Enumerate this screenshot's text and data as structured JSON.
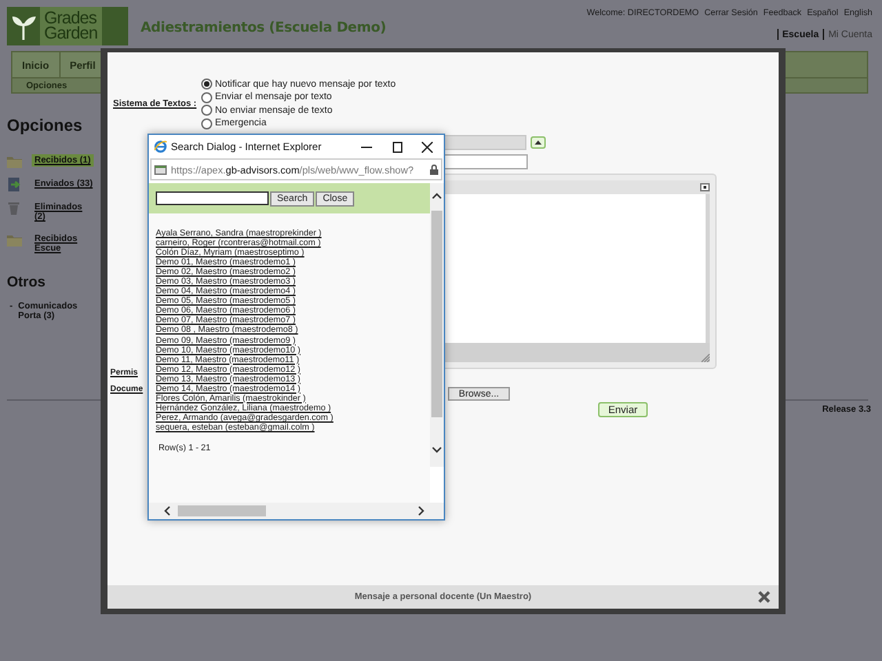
{
  "header": {
    "logo_words": [
      "Grades",
      "Garden"
    ],
    "title": "Adiestramientos (Escuela Demo)",
    "top_links": [
      "Welcome: DIRECTORDEMO",
      "Cerrar Sesión",
      "Feedback",
      "Español",
      "English"
    ],
    "account_links": [
      {
        "label": "Escuela",
        "selected": true
      },
      {
        "label": "Mi Cuenta",
        "selected": false
      }
    ]
  },
  "nav": {
    "tabs": [
      "Inicio",
      "Perfil"
    ],
    "subnav": [
      "Opciones"
    ]
  },
  "sidebar": {
    "heading": "Opciones",
    "items": [
      {
        "label": "Recibidos (1)",
        "kind": "folder",
        "selected": true
      },
      {
        "label": "Enviados (33)",
        "kind": "sent",
        "selected": false
      },
      {
        "label": "Eliminados (2)",
        "kind": "trash",
        "selected": false
      },
      {
        "label": "Recibidos Escue",
        "kind": "folder",
        "selected": false
      }
    ],
    "others_heading": "Otros",
    "others": [
      {
        "marker": "-",
        "label": "Comunicados Porta (3)"
      }
    ]
  },
  "release": "Release 3.3",
  "modal": {
    "sms_label": "Sistema de Textos :",
    "sms_options": [
      {
        "label": "Notificar que hay nuevo mensaje por texto",
        "selected": true
      },
      {
        "label": "Enviar el mensaje por texto",
        "selected": false
      },
      {
        "label": "No enviar mensaje de texto",
        "selected": false
      },
      {
        "label": "Emergencia",
        "selected": false
      }
    ],
    "permissions_label": "Permis",
    "document_label": "Docume",
    "browse_button": "Browse...",
    "send_button": "Enviar",
    "footer_title": "Mensaje a personal docente (Un Maestro)"
  },
  "popup": {
    "title": "Search Dialog - Internet Explorer",
    "url": [
      "https://apex.",
      "gb-advisors.com",
      "/pls/web/wwv_flow.show?"
    ],
    "search_button": "Search",
    "close_button": "Close",
    "results": [
      "Ayala Serrano, Sandra (maestroprekinder )",
      "carneiro, Roger (rcontreras@hotmail.com )",
      "Colón Díaz, Myriam (maestroseptimo )",
      "Demo 01, Maestro (maestrodemo1 )",
      "Demo 02, Maestro (maestrodemo2 )",
      "Demo 03, Maestro (maestrodemo3 )",
      "Demo 04, Maestro (maestrodemo4 )",
      "Demo 05, Maestro (maestrodemo5 )",
      "Demo 06, Maestro (maestrodemo6 )",
      "Demo 07, Maestro (maestrodemo7 )",
      "Demo 08 , Maestro (maestrodemo8 )",
      "Demo 09, Maestro (maestrodemo9 )",
      "Demo 10, Maestro (maestrodemo10 )",
      "Demo 11, Maestro (maestrodemo11 )",
      "Demo 12, Maestro (maestrodemo12 )",
      "Demo 13, Maestro (maestrodemo13 )",
      "Demo 14, Maestro (maestrodemo14 )",
      "Flores Colón, Amarilis (maestrokinder )",
      "Hernández González, Liliana (maestrodemo )",
      "Perez, Armando (avega@gradesgarden.com )",
      "sequera, esteban (esteban@gmail.colm )"
    ],
    "row_count": "Row(s) 1 - 21"
  }
}
